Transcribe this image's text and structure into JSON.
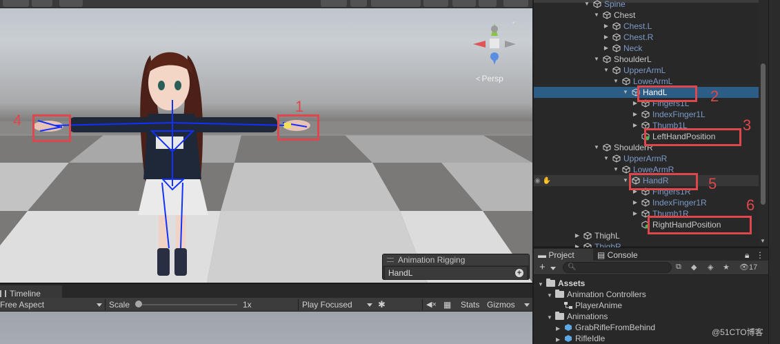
{
  "scene": {
    "persp_label": "Persp",
    "overlay_title": "Animation Rigging",
    "overlay_field": "HandL",
    "callouts": [
      "1",
      "2",
      "3",
      "4",
      "5",
      "6"
    ]
  },
  "timeline": {
    "tab_label": "Timeline"
  },
  "game_toolbar": {
    "aspect": "Free Aspect",
    "scale_label": "Scale",
    "scale_value": "1x",
    "play_mode": "Play Focused",
    "stats": "Stats",
    "gizmos": "Gizmos"
  },
  "hierarchy": {
    "rows": [
      {
        "label": "Spine",
        "inactive": true
      },
      {
        "label": "Chest"
      },
      {
        "label": "Chest.L",
        "inactive": true
      },
      {
        "label": "Chest.R",
        "inactive": true
      },
      {
        "label": "Neck",
        "inactive": true
      },
      {
        "label": "ShoulderL"
      },
      {
        "label": "UpperArmL",
        "inactive": true
      },
      {
        "label": "LoweArmL",
        "inactive": true
      },
      {
        "label": "HandL",
        "selected": true
      },
      {
        "label": "Fingers1L",
        "inactive": true
      },
      {
        "label": "IndexFinger1L",
        "inactive": true
      },
      {
        "label": "Thumb1L",
        "inactive": true
      },
      {
        "label": "LeftHandPosition"
      },
      {
        "label": "ShoulderR"
      },
      {
        "label": "UpperArmR",
        "inactive": true
      },
      {
        "label": "LoweArmR",
        "inactive": true
      },
      {
        "label": "HandR",
        "inactive": true
      },
      {
        "label": "Fingers1R",
        "inactive": true
      },
      {
        "label": "IndexFinger1R",
        "inactive": true
      },
      {
        "label": "Thumb1R",
        "inactive": true
      },
      {
        "label": "RightHandPosition"
      },
      {
        "label": "ThighL"
      },
      {
        "label": "ThighR",
        "inactive": true
      }
    ]
  },
  "project": {
    "tab_project": "Project",
    "tab_console": "Console",
    "hidden_count": "17",
    "tree": [
      {
        "label": "Assets"
      },
      {
        "label": "Animation Controllers"
      },
      {
        "label": "PlayerAnime"
      },
      {
        "label": "Animations"
      },
      {
        "label": "GrabRifleFromBehind"
      },
      {
        "label": "RifleIdle"
      }
    ]
  },
  "watermark": "@51CTO博客",
  "colors": {
    "selection": "#2c5d87",
    "callout_red": "#e0474c",
    "panel_bg": "#282828",
    "inactive_text": "#7d9ac8"
  }
}
